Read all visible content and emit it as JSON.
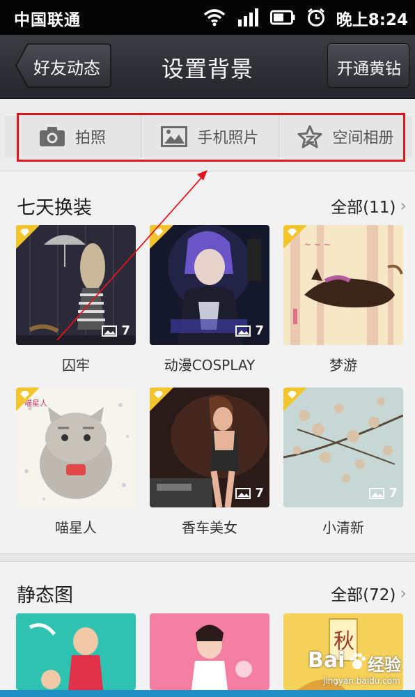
{
  "status_bar": {
    "carrier": "中国联通",
    "time": "晚上8:24"
  },
  "title_bar": {
    "back_label": "好友动态",
    "title": "设置背景",
    "right_button": "开通黄钻"
  },
  "source_tabs": [
    {
      "label": "拍照",
      "icon": "camera-icon"
    },
    {
      "label": "手机照片",
      "icon": "image-icon"
    },
    {
      "label": "空间相册",
      "icon": "star-album-icon"
    }
  ],
  "sections": [
    {
      "title": "七天换装",
      "more": "全部(11)",
      "items": [
        {
          "caption": "囚牢",
          "count": "7"
        },
        {
          "caption": "动漫COSPLAY",
          "count": "7"
        },
        {
          "caption": "梦游",
          "count": ""
        },
        {
          "caption": "喵星人",
          "count": ""
        },
        {
          "caption": "香车美女",
          "count": "7"
        },
        {
          "caption": "小清新",
          "count": "7"
        }
      ]
    },
    {
      "title": "静态图",
      "more": "全部(72)",
      "items": [
        {
          "caption": "",
          "count": ""
        },
        {
          "caption": "",
          "count": ""
        },
        {
          "caption": "",
          "count": ""
        }
      ]
    }
  ],
  "watermark": {
    "brand": "Bai",
    "suffix": "经验",
    "url": "jingyan.baidu.com"
  },
  "colors": {
    "highlight": "#e2141c",
    "vip_badge": "#f3c52b",
    "title_bar": "#2b2e33"
  }
}
